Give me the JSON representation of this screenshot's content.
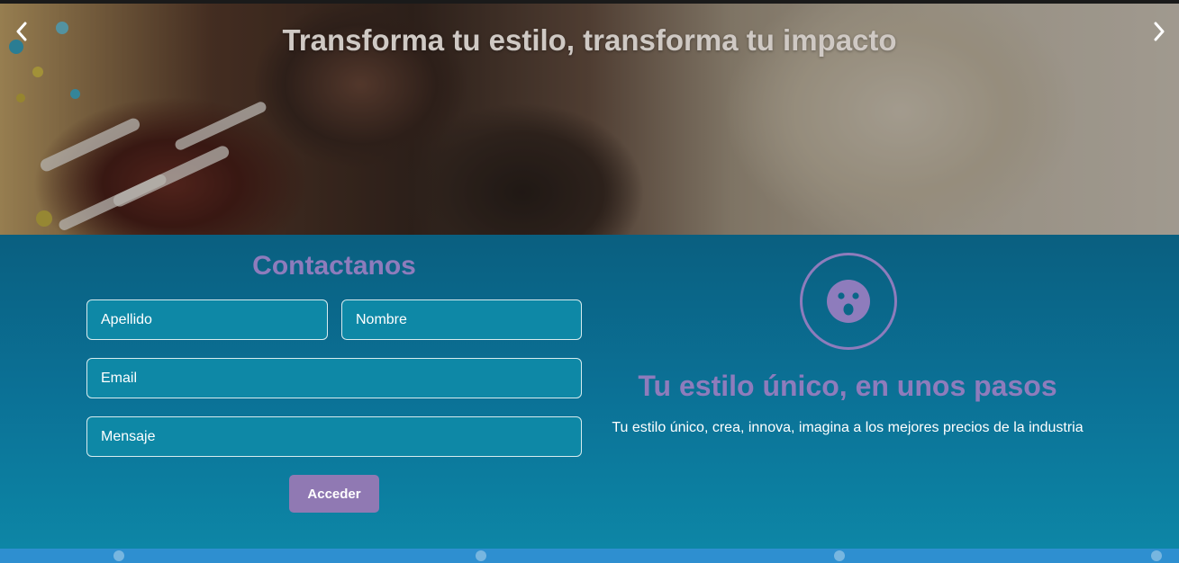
{
  "hero": {
    "title": "Transforma tu estilo, transforma tu impacto",
    "prev_icon": "chevron-left-icon",
    "next_icon": "chevron-right-icon"
  },
  "contact": {
    "title": "Contactanos",
    "fields": {
      "apellido_placeholder": "Apellido",
      "nombre_placeholder": "Nombre",
      "email_placeholder": "Email",
      "mensaje_placeholder": "Mensaje"
    },
    "submit_label": "Acceder"
  },
  "feature": {
    "icon": "surprised-face-icon",
    "title": "Tu estilo único, en unos pasos",
    "text": "Tu estilo único, crea, innova, imagina a los mejores precios de la industria"
  },
  "colors": {
    "accent": "#8e7cbc",
    "section_bg": "#0b7196",
    "input_bg": "#0e88a6",
    "button_bg": "#9079b3"
  }
}
